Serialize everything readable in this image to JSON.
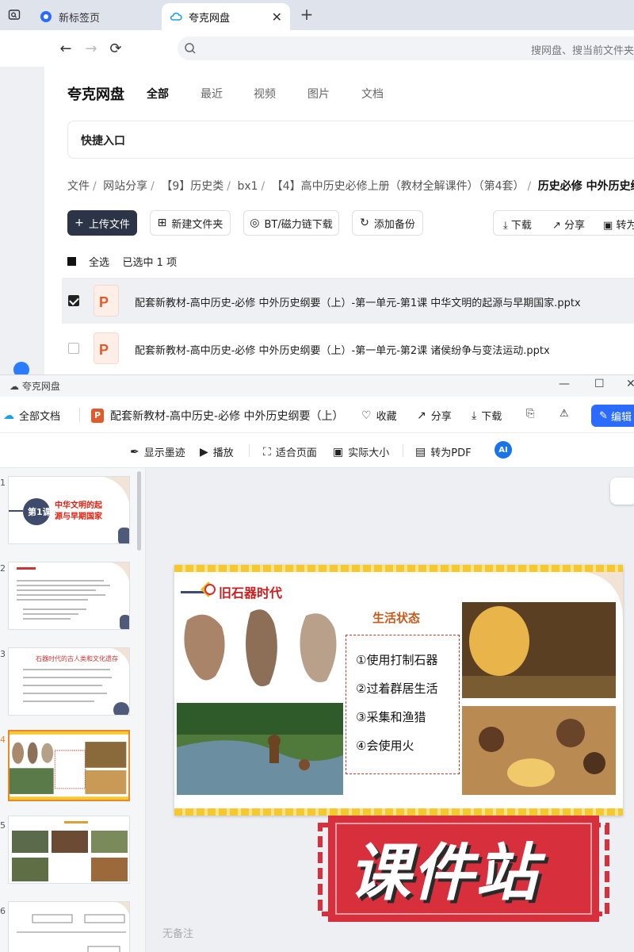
{
  "browser": {
    "tabs": [
      {
        "label": "新标签页",
        "active": false
      },
      {
        "label": "夸克网盘",
        "active": true
      }
    ],
    "address_placeholder": "搜网盘、搜当前文件夹"
  },
  "drive": {
    "logo": "夸克网盘",
    "nav": [
      "全部",
      "最近",
      "视频",
      "图片",
      "文档"
    ],
    "quick_entry": "快捷入口",
    "breadcrumb": [
      "文件",
      "网站分享",
      "【9】历史类",
      "bx1",
      "【4】高中历史必修上册（教材全解课件）（第4套）",
      "历史必修 中外历史纲要（上）"
    ],
    "toolbar": {
      "upload": "上传文件",
      "new_folder": "新建文件夹",
      "bt": "BT/磁力链下载",
      "backup": "添加备份",
      "download": "下载",
      "share": "分享",
      "convert": "转为"
    },
    "select_all": "全选",
    "selected_count": "已选中 1 项",
    "files": [
      {
        "name": "配套新教材-高中历史-必修 中外历史纲要（上）-第一单元-第1课 中华文明的起源与早期国家.pptx",
        "checked": true
      },
      {
        "name": "配套新教材-高中历史-必修 中外历史纲要（上）-第一单元-第2课 诸侯纷争与变法运动.pptx",
        "checked": false
      }
    ]
  },
  "viewer": {
    "window_title": "夸克网盘",
    "all_docs": "全部文档",
    "doc_title": "配套新教材-高中历史-必修 中外历史纲要（上）",
    "actions": {
      "favorite": "收藏",
      "share": "分享",
      "download": "下载",
      "edit": "编辑"
    },
    "tools": {
      "ink": "显示墨迹",
      "play": "播放",
      "fit": "适合页面",
      "actual": "实际大小",
      "pdf": "转为PDF",
      "ai": "AI"
    },
    "thumb_numbers": [
      "1",
      "2",
      "3",
      "4",
      "5",
      "6"
    ],
    "active_thumb": 4,
    "thumb1_title": "中华文明的起源与早期国家",
    "thumb1_badge": "第1课",
    "thumb3_title": "石器时代的古人类和文化遗存",
    "notes": "无备注"
  },
  "slide": {
    "title": "旧石器时代",
    "life_title": "生活状态",
    "items": [
      "①使用打制石器",
      "②过着群居生活",
      "③采集和渔猎",
      "④会使用火"
    ]
  },
  "watermark": "课件站",
  "colors": {
    "accent": "#2b6cff",
    "primary_dark": "#2c3447",
    "stamp_red": "#d7303c",
    "slide_red": "#c81e1e"
  }
}
